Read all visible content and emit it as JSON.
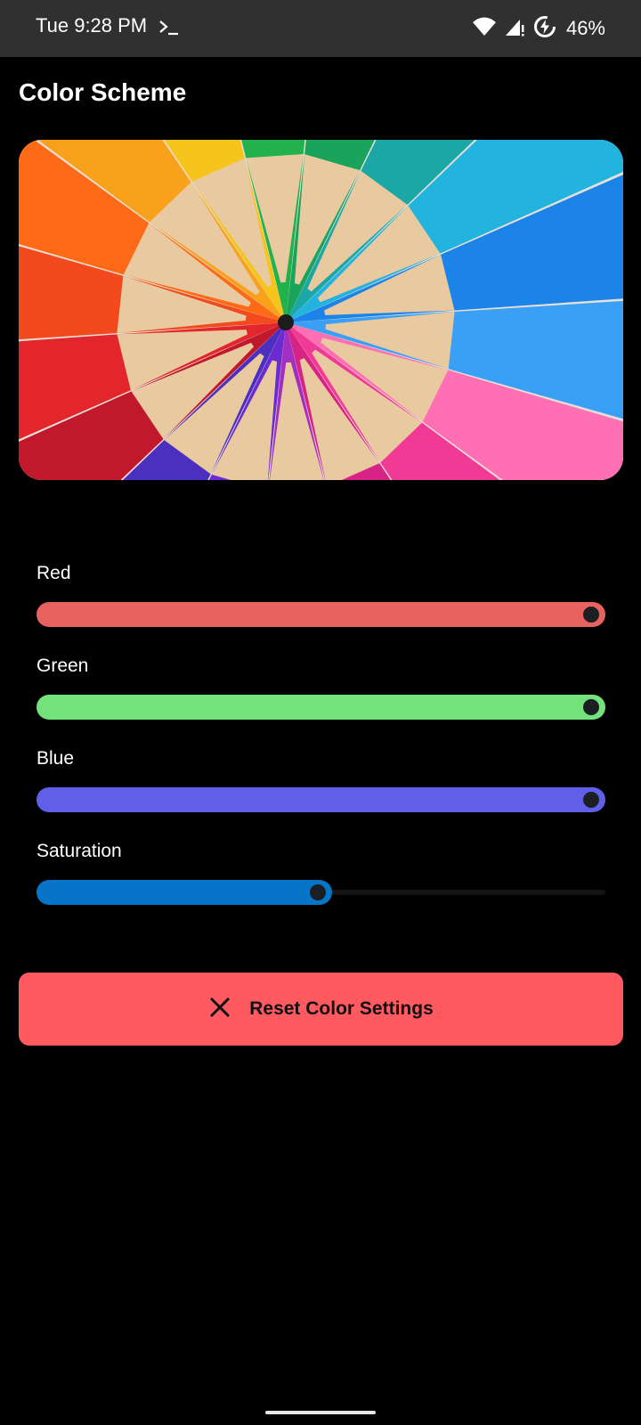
{
  "status_bar": {
    "time": "Tue 9:28 PM",
    "battery_percent": "46%",
    "icons": [
      "terminal-icon",
      "wifi-icon",
      "signal-icon",
      "battery-saver-icon"
    ]
  },
  "page": {
    "title": "Color Scheme"
  },
  "hero_image": {
    "description_icon": "colored-pencils-image"
  },
  "sliders": [
    {
      "id": "red",
      "label": "Red",
      "value": 1.0,
      "color": "#e8635f"
    },
    {
      "id": "green",
      "label": "Green",
      "value": 1.0,
      "color": "#72e37a"
    },
    {
      "id": "blue",
      "label": "Blue",
      "value": 1.0,
      "color": "#5f5fea"
    },
    {
      "id": "saturation",
      "label": "Saturation",
      "value": 0.52,
      "color": "#0574c9"
    }
  ],
  "reset_button": {
    "label": "Reset Color Settings",
    "icon": "close-icon",
    "color": "#ff5a60"
  }
}
